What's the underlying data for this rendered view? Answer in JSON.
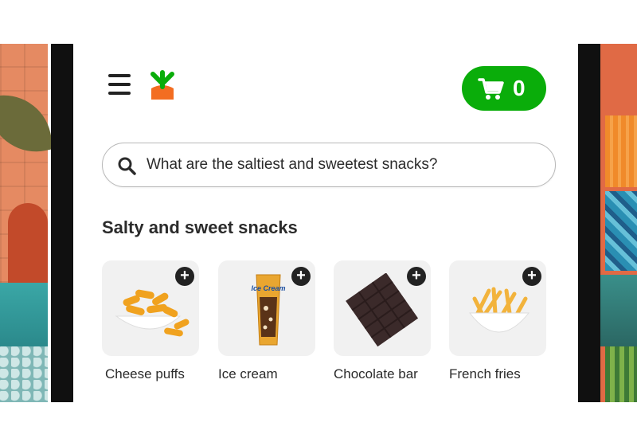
{
  "header": {
    "menu_icon": "hamburger-menu-icon",
    "logo_icon": "carrot-logo-icon",
    "cart": {
      "icon": "shopping-cart-icon",
      "count": "0",
      "color": "#0aad0a"
    }
  },
  "search": {
    "icon": "search-icon",
    "value": "What are the saltiest and sweetest snacks?"
  },
  "section": {
    "title": "Salty and sweet snacks"
  },
  "products": [
    {
      "label": "Cheese puffs",
      "icon": "cheese-puffs-image"
    },
    {
      "label": "Ice cream",
      "icon": "ice-cream-bar-image",
      "packaging_text": "Ice Cream"
    },
    {
      "label": "Chocolate bar",
      "icon": "chocolate-bar-image"
    },
    {
      "label": "French fries",
      "icon": "french-fries-image"
    }
  ],
  "add_button_label": "+"
}
